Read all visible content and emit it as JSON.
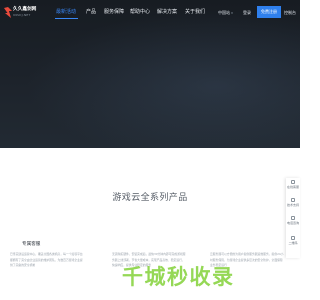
{
  "logo": {
    "title": "久久鑫剑网",
    "subtitle": "99SDJ.NET"
  },
  "nav": {
    "items": [
      {
        "label": "最新活动",
        "active": true
      },
      {
        "label": "产品",
        "active": false
      },
      {
        "label": "服务保障",
        "active": false
      },
      {
        "label": "帮助中心",
        "active": false
      },
      {
        "label": "解决方案",
        "active": false
      },
      {
        "label": "关于我们",
        "active": false
      }
    ],
    "language": "中国站",
    "login": "登录",
    "register": "免费注册",
    "console": "控制台"
  },
  "section": {
    "title": "游戏云全系列产品"
  },
  "cards": [
    {
      "title": "专属客服",
      "text": "已坚实建设运营中心，覆盖全国各类机房，每一个接驳平台都拥有了完全由企业运营的维护团队，为数百万游戏企业提供了完备的安全机制"
    },
    {
      "title": "",
      "text": "无需购买硬件，安装完成后，最快30分钟内即可完成游戏服务器上线部署，节省大量成本，实现产品高效、稳定运行，快速响应，提供专业稳定的服务"
    },
    {
      "title": "",
      "text": "云服务器可以方便的为用户提供服务器运维服务，提供24小时服务保障，为游戏企业提供多层次的安全防护，全面保障业务稳定运行"
    }
  ],
  "watermark": "千城秒收录",
  "float_bar": {
    "items": [
      "在线客服",
      "技术支持",
      "电话咨询",
      "二维码"
    ]
  }
}
